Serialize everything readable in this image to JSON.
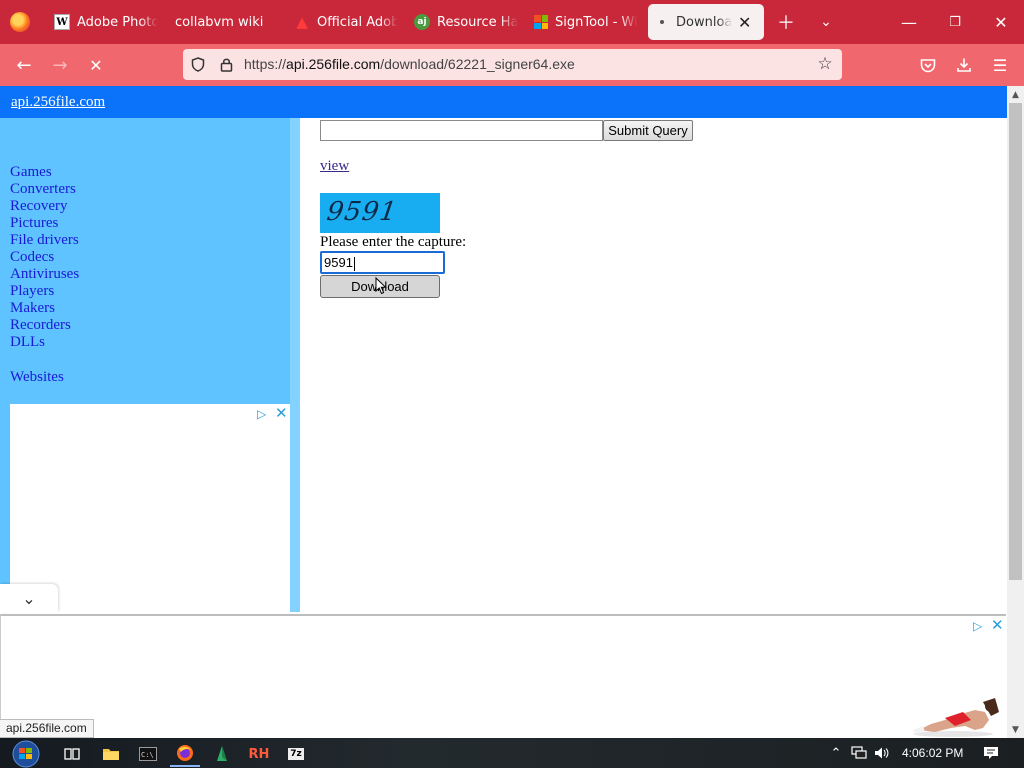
{
  "browser": {
    "tabs": [
      {
        "title": "Adobe Photos",
        "favicon": "wikipedia-w-icon"
      },
      {
        "title": "collabvm wiki",
        "favicon": "none"
      },
      {
        "title": "Official Adobe",
        "favicon": "adobe-icon"
      },
      {
        "title": "Resource Hacl",
        "favicon": "angusj-icon"
      },
      {
        "title": "SignTool - Win",
        "favicon": "microsoft-icon"
      },
      {
        "title": "Download fi",
        "favicon": "loading-dot",
        "active": true
      }
    ],
    "url": {
      "scheme": "https://",
      "host": "api.256file.com",
      "path": "/download/62221_signer64.exe"
    },
    "status_url": "api.256file.com"
  },
  "site": {
    "header_link": "api.256file.com",
    "categories": [
      "Games",
      "Converters",
      "Recovery",
      "Pictures",
      "File drivers",
      "Codecs",
      "Antiviruses",
      "Players",
      "Makers",
      "Recorders",
      "DLLs"
    ],
    "websites_link": "Websites",
    "search_value": "",
    "submit_label": "Submit Query",
    "view_link": "view",
    "captcha_code": "9591",
    "captcha_prompt": "Please enter the capture:",
    "captcha_input_value": "9591",
    "download_label": "Download"
  },
  "taskbar": {
    "clock": "4:06:02 PM",
    "apps": [
      "task-view",
      "file-explorer",
      "command-prompt",
      "firefox",
      "green-app",
      "resource-hacker",
      "7zip"
    ],
    "app_labels": {
      "cmd": "C:\\",
      "rh": "RH",
      "sevenzip": "7z"
    }
  },
  "colors": {
    "tabstrip": "#c8283a",
    "navbar": "#f0686e",
    "site_header": "#0a73fa",
    "sidebar": "#5fc3ff",
    "captcha_bg": "#18adf0"
  }
}
